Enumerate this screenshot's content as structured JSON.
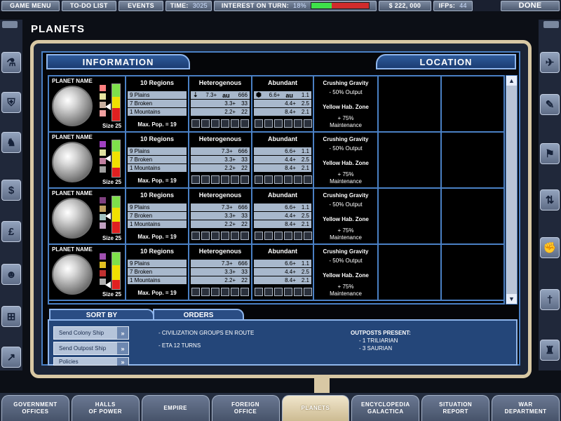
{
  "topbar": {
    "game_menu": "GAME MENU",
    "todo": "TO-DO LIST",
    "events": "EVENTS",
    "time_label": "TIME:",
    "time_value": "3025",
    "interest_label": "INTEREST ON TURN:",
    "interest_value": "18%",
    "interest_fraction": 0.18,
    "money": "$ 222, 000",
    "ifps_label": "IFPs:",
    "ifps_value": "44",
    "done": "DONE"
  },
  "page": {
    "title": "PLANETS"
  },
  "headers": {
    "information": "INFORMATION",
    "location": "LOCATION"
  },
  "planet_cols": {
    "regions_header": "10 Regions",
    "het_header": "Heterogenous",
    "abu_header": "Abundant",
    "max_pop": "Max. Pop. = 19"
  },
  "planets": [
    {
      "name": "PLANET NAME",
      "size": "Size 25",
      "regions": [
        "9 Plains",
        "7 Broken",
        "1 Mountains"
      ],
      "het": [
        [
          "7.3+",
          "666"
        ],
        [
          "3.3+",
          "33"
        ],
        [
          "2.2+",
          "22"
        ]
      ],
      "abu": [
        [
          "6.6+",
          "1.1"
        ],
        [
          "4.4+",
          "2.5"
        ],
        [
          "8.4+",
          "2.1"
        ]
      ],
      "het_symbol": "au",
      "abu_symbol": "au",
      "trait1": "Crushing Gravity",
      "trait1_effect": "- 50% Output",
      "trait2": "Yellow Hab. Zone",
      "trait2_effect": "+ 75%",
      "trait2_effect2": "Maintenance"
    },
    {
      "name": "PLANET NAME",
      "size": "Size 25",
      "regions": [
        "9 Plains",
        "7 Broken",
        "1 Mountains"
      ],
      "het": [
        [
          "7.3+",
          "666"
        ],
        [
          "3.3+",
          "33"
        ],
        [
          "2.2+",
          "22"
        ]
      ],
      "abu": [
        [
          "6.6+",
          "1.1"
        ],
        [
          "4.4+",
          "2.5"
        ],
        [
          "8.4+",
          "2.1"
        ]
      ],
      "trait1": "Crushing Gravity",
      "trait1_effect": "- 50% Output",
      "trait2": "Yellow Hab. Zone",
      "trait2_effect": "+ 75%",
      "trait2_effect2": "Maintenance"
    },
    {
      "name": "PLANET NAME",
      "size": "Size 25",
      "regions": [
        "9 Plains",
        "7 Broken",
        "1 Mountains"
      ],
      "het": [
        [
          "7.3+",
          "666"
        ],
        [
          "3.3+",
          "33"
        ],
        [
          "2.2+",
          "22"
        ]
      ],
      "abu": [
        [
          "6.6+",
          "1.1"
        ],
        [
          "4.4+",
          "2.5"
        ],
        [
          "8.4+",
          "2.1"
        ]
      ],
      "trait1": "Crushing Gravity",
      "trait1_effect": "- 50% Output",
      "trait2": "Yellow Hab. Zone",
      "trait2_effect": "+ 75%",
      "trait2_effect2": "Maintenance"
    },
    {
      "name": "PLANET NAME",
      "size": "Size 25",
      "regions": [
        "9 Plains",
        "7 Broken",
        "1 Mountains"
      ],
      "het": [
        [
          "7.3+",
          "666"
        ],
        [
          "3.3+",
          "33"
        ],
        [
          "2.2+",
          "22"
        ]
      ],
      "abu": [
        [
          "6.6+",
          "1.1"
        ],
        [
          "4.4+",
          "2.5"
        ],
        [
          "8.4+",
          "2.1"
        ]
      ],
      "trait1": "Crushing Gravity",
      "trait1_effect": "- 50% Output",
      "trait2": "Yellow Hab. Zone",
      "trait2_effect": "+ 75%",
      "trait2_effect2": "Maintenance"
    }
  ],
  "bottom": {
    "sort_by": "SORT BY",
    "orders": "ORDERS",
    "buttons": [
      "Send Colony Ship",
      "Send Outpost Ship",
      "Policies"
    ],
    "line1": "- CIVILIZATION GROUPS EN ROUTE",
    "line2": "- ETA 12 TURNS",
    "outposts_title": "OUTPOSTS PRESENT:",
    "outpost1": "- 1 TRILIARIAN",
    "outpost2": "- 3 SAURIAN"
  },
  "nav": [
    "GOVERNMENT\nOFFICES",
    "HALLS\nOF POWER",
    "EMPIRE",
    "FOREIGN\nOFFICE",
    "PLANETS",
    "ENCYCLOPEDIA\nGALACTICA",
    "SITUATION\nREPORT",
    "WAR\nDEPARTMENT"
  ],
  "icons": {
    "left": [
      "flask-icon",
      "shield-icon",
      "dragon-icon",
      "dollar-icon",
      "pound-icon",
      "group-icon",
      "network-icon",
      "line-chart-icon"
    ],
    "right": [
      "ship-icon",
      "wrench-icon",
      "flag-icon",
      "arrows-icon",
      "fist-icon",
      "dagger-icon",
      "trophy-icon"
    ]
  },
  "colors": {
    "frame": "#d8c8a4",
    "panel_blue": "#244679",
    "table_border": "#4a80c4",
    "row_fill": "#a8b8cc"
  }
}
